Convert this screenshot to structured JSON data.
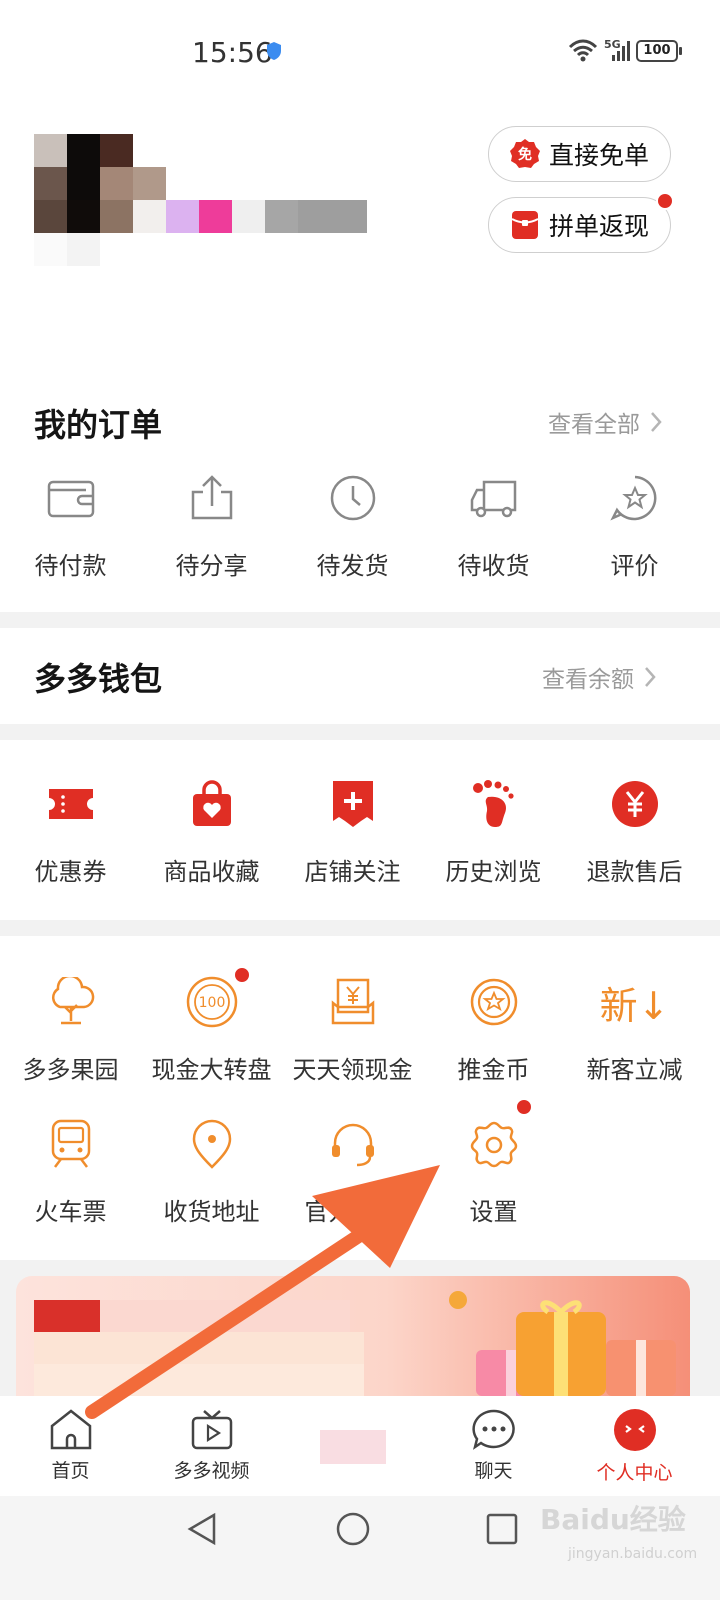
{
  "status_bar": {
    "time": "15:56",
    "network": "5G",
    "battery": "100"
  },
  "header": {
    "actions": [
      {
        "label": "直接免单",
        "badge": "免"
      },
      {
        "label": "拼单返现"
      }
    ]
  },
  "orders": {
    "title": "我的订单",
    "link": "查看全部",
    "items": [
      {
        "label": "待付款",
        "icon": "wallet-icon"
      },
      {
        "label": "待分享",
        "icon": "share-icon"
      },
      {
        "label": "待发货",
        "icon": "clock-icon"
      },
      {
        "label": "待收货",
        "icon": "truck-icon"
      },
      {
        "label": "评价",
        "icon": "star-bubble-icon"
      }
    ]
  },
  "wallet": {
    "title": "多多钱包",
    "link": "查看余额"
  },
  "quick": {
    "items": [
      {
        "label": "优惠券",
        "icon": "coupon-icon"
      },
      {
        "label": "商品收藏",
        "icon": "heart-bag-icon"
      },
      {
        "label": "店铺关注",
        "icon": "shop-plus-icon"
      },
      {
        "label": "历史浏览",
        "icon": "footprint-icon"
      },
      {
        "label": "退款售后",
        "icon": "yen-circle-icon"
      }
    ]
  },
  "services": {
    "row1": [
      {
        "label": "多多果园",
        "icon": "tree-icon"
      },
      {
        "label": "现金大转盘",
        "icon": "wheel-100-icon"
      },
      {
        "label": "天天领现金",
        "icon": "cash-box-icon"
      },
      {
        "label": "推金币",
        "icon": "coin-icon"
      },
      {
        "label": "新客立减",
        "icon": "new-down-icon",
        "glyph": "新↓"
      }
    ],
    "row2": [
      {
        "label": "火车票",
        "icon": "train-icon"
      },
      {
        "label": "收货地址",
        "icon": "location-pin-icon"
      },
      {
        "label": "官方客服",
        "icon": "headset-icon"
      },
      {
        "label": "设置",
        "icon": "gear-icon"
      }
    ]
  },
  "tabs": [
    {
      "label": "首页",
      "icon": "home-icon"
    },
    {
      "label": "多多视频",
      "icon": "video-tv-icon"
    },
    {
      "label": "",
      "icon": ""
    },
    {
      "label": "聊天",
      "icon": "chat-icon"
    },
    {
      "label": "个人中心",
      "icon": "profile-face-icon"
    }
  ],
  "watermark": {
    "text": "Baidu经验",
    "sub": "jingyan.baidu.com"
  },
  "colors": {
    "brand_red": "#e02e24",
    "orange": "#f08d2c",
    "arrow": "#f26b3a"
  }
}
